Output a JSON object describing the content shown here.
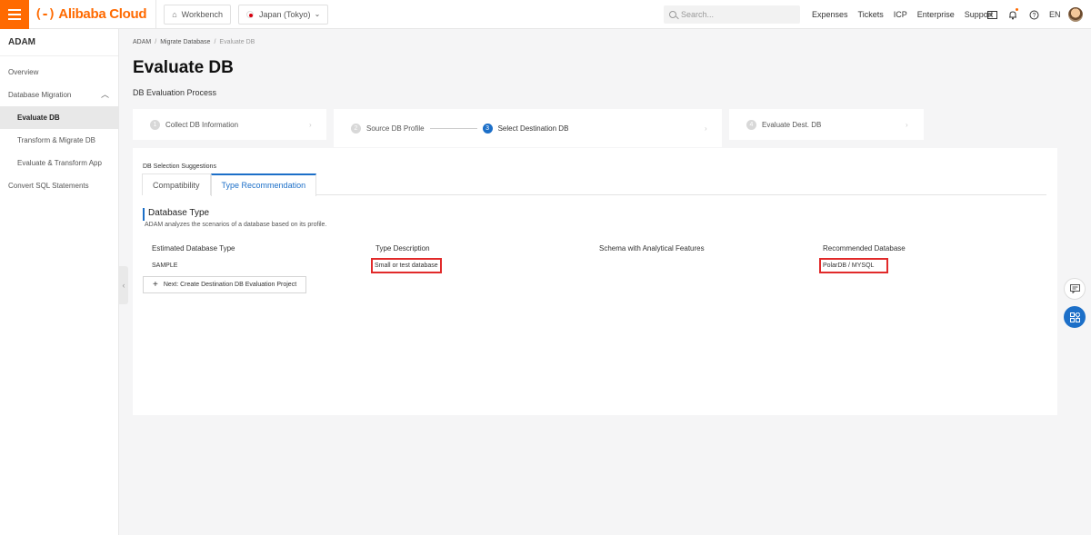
{
  "topbar": {
    "logo_text": "Alibaba Cloud",
    "logo_mark": "(-)",
    "workbench_label": "Workbench",
    "region_label": "Japan (Tokyo)",
    "search_placeholder": "Search...",
    "links": [
      "Expenses",
      "Tickets",
      "ICP",
      "Enterprise",
      "Support"
    ],
    "lang": "EN",
    "accent_color": "#ff6a00"
  },
  "sidebar": {
    "title": "ADAM",
    "items": [
      {
        "label": "Overview"
      },
      {
        "label": "Database Migration"
      },
      {
        "label": "Evaluate DB"
      },
      {
        "label": "Transform & Migrate DB"
      },
      {
        "label": "Evaluate & Transform App"
      },
      {
        "label": "Convert SQL Statements"
      }
    ]
  },
  "breadcrumb": [
    "ADAM",
    "Migrate Database",
    "Evaluate DB"
  ],
  "page": {
    "title": "Evaluate DB",
    "process_label": "DB Evaluation Process"
  },
  "steps": [
    {
      "num": "1",
      "label": "Collect DB Information"
    },
    {
      "num": "2",
      "label": "Source DB Profile"
    },
    {
      "num": "3",
      "label": "Select Destination DB"
    },
    {
      "num": "4",
      "label": "Evaluate Dest. DB"
    }
  ],
  "panel": {
    "selection_label": "DB Selection Suggestions",
    "tabs": [
      "Compatibility",
      "Type Recommendation"
    ],
    "section_title": "Database Type",
    "section_desc": "ADAM analyzes the scenarios of a database based on its profile.",
    "columns": [
      "Estimated Database Type",
      "Type Description",
      "Schema with Analytical Features",
      "Recommended Database"
    ],
    "row": {
      "type": "SAMPLE",
      "description": "Small or test database",
      "schema": "",
      "recommended": "PolarDB / MYSQL"
    },
    "next_button": "Next: Create Destination DB Evaluation Project"
  },
  "colors": {
    "primary": "#1c6fc8",
    "highlight": "#e12a2a"
  }
}
